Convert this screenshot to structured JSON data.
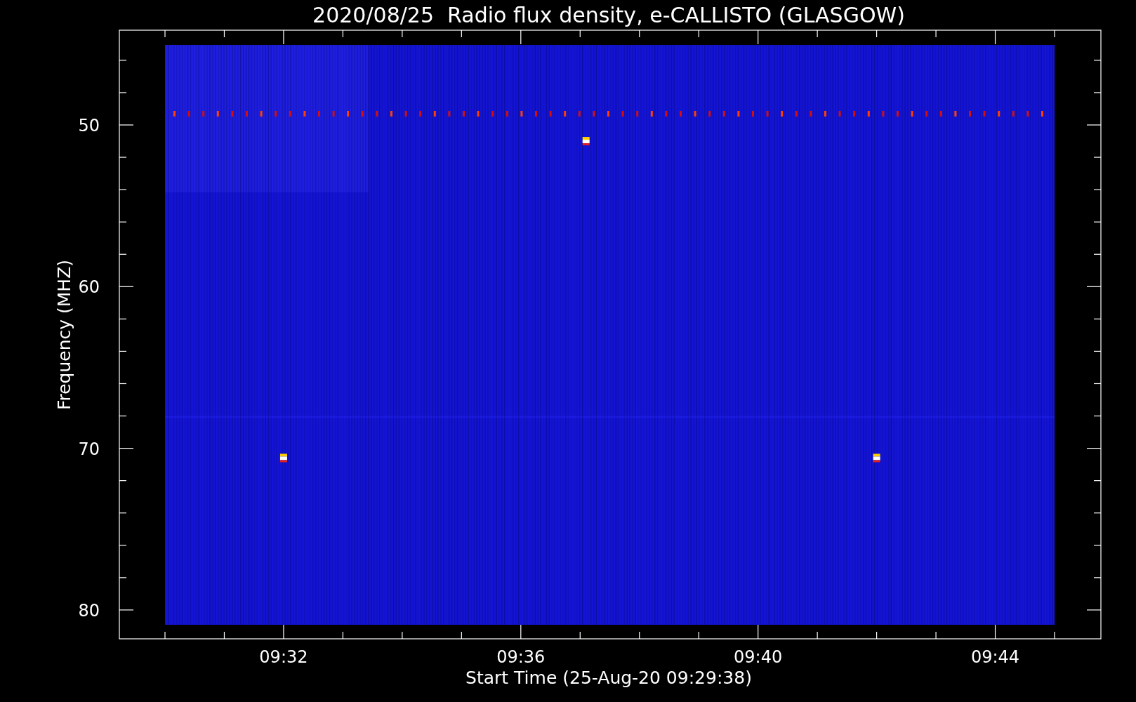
{
  "plot": {
    "title": "2020/08/25  Radio flux density, e-CALLISTO (GLASGOW)",
    "ylabel": "Frequency (MHZ)",
    "xlabel": "Start Time (25-Aug-20 09:29:38)",
    "yticks": [
      "50",
      "60",
      "70",
      "80"
    ],
    "xticks": [
      "09:32",
      "09:36",
      "09:40",
      "09:44"
    ]
  }
}
